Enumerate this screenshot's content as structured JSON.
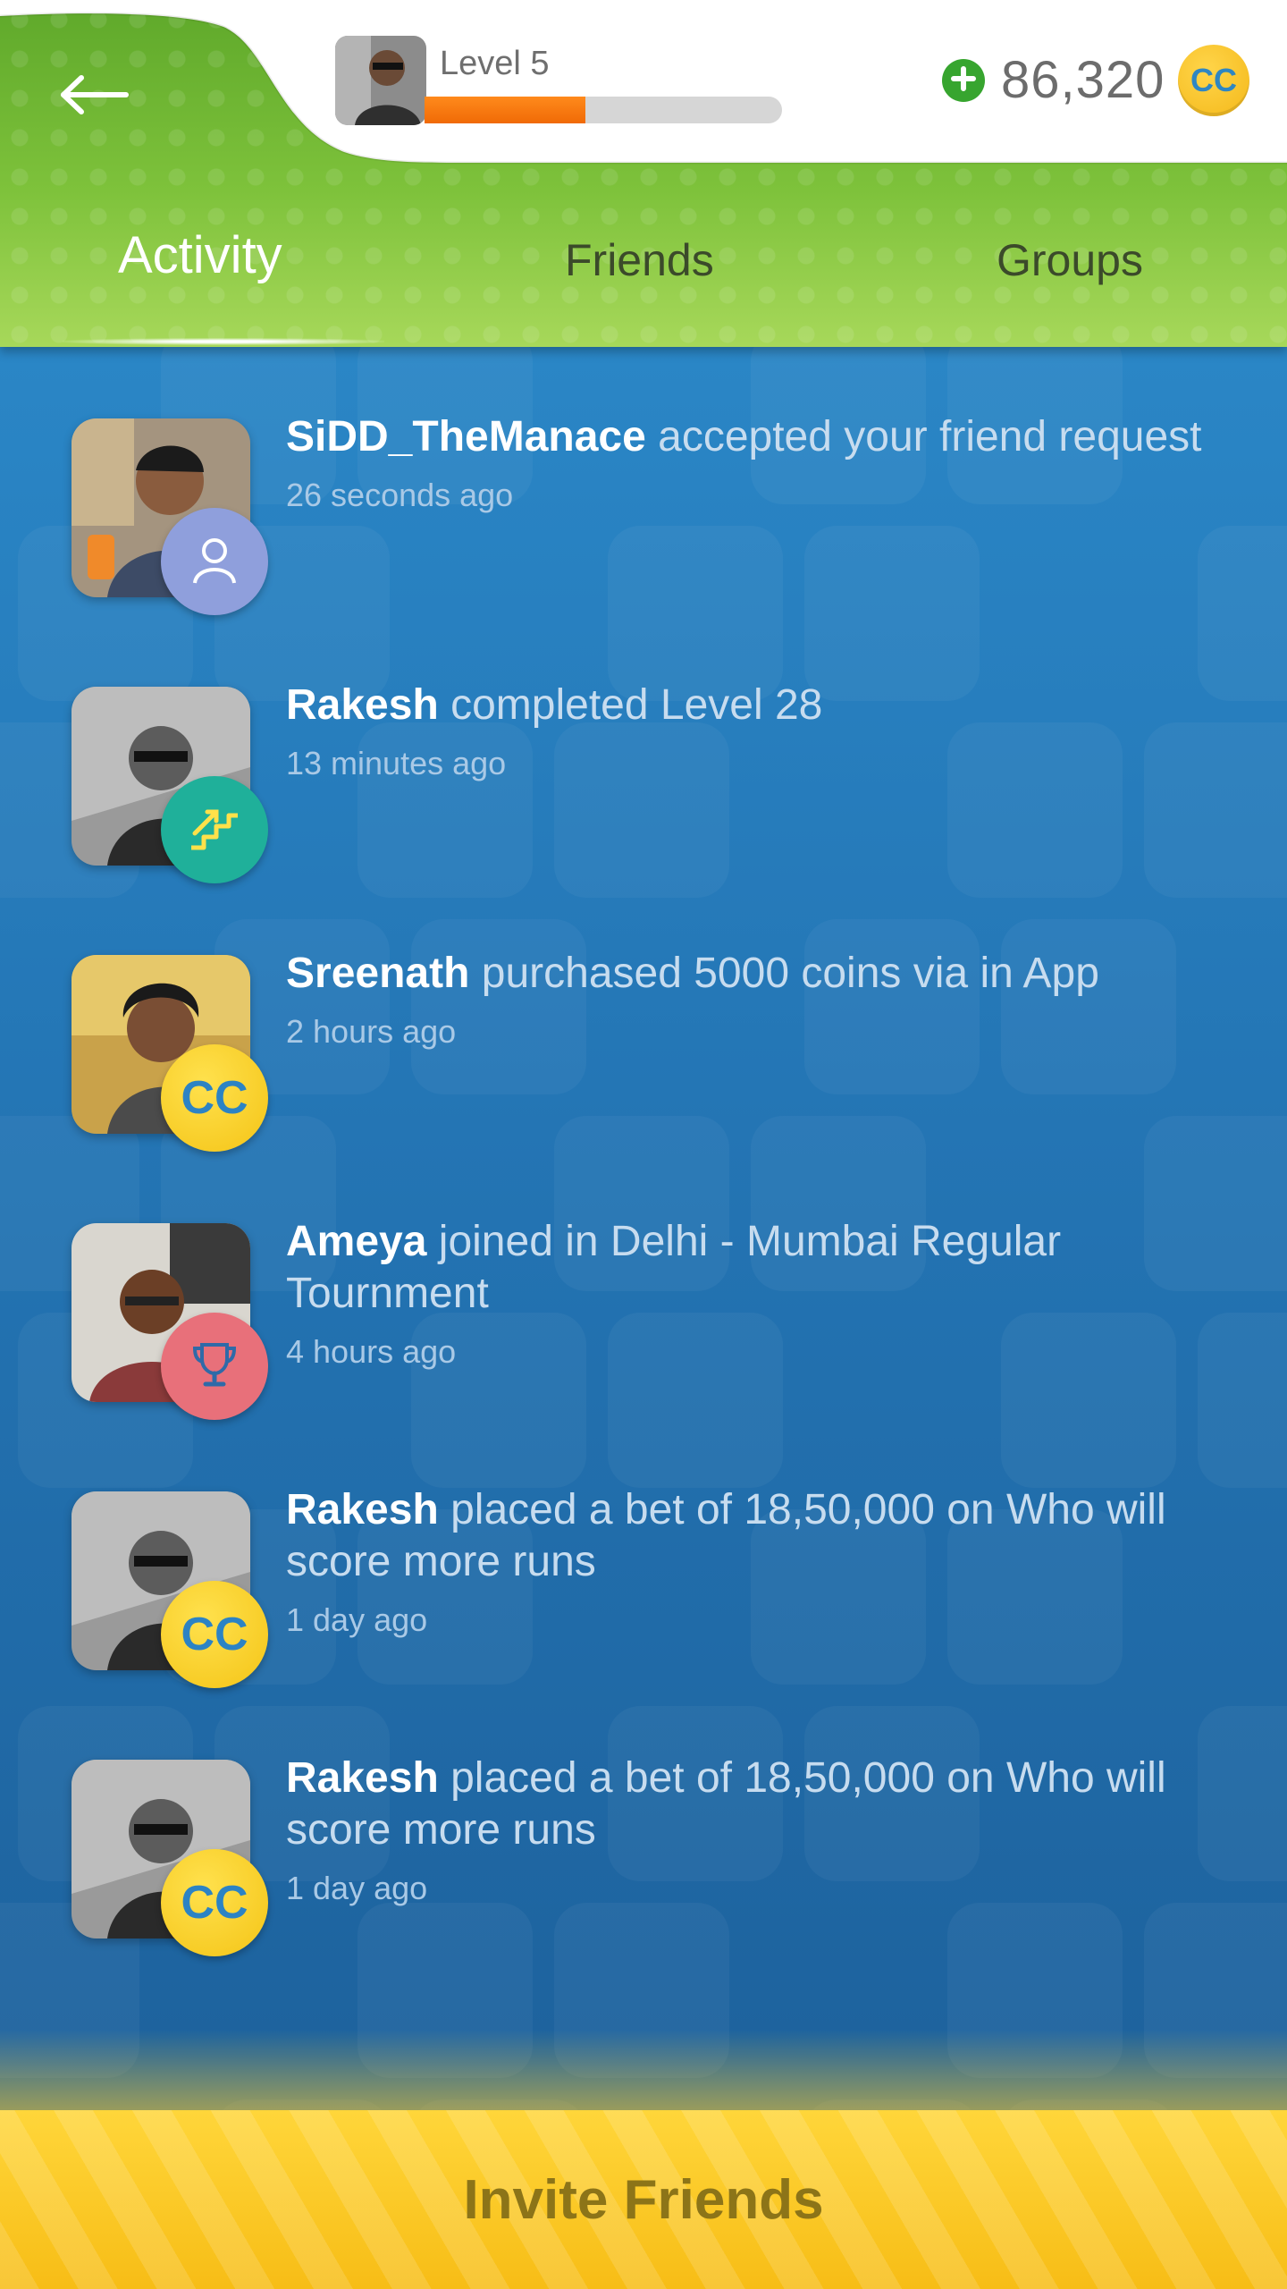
{
  "header": {
    "level_label": "Level 5",
    "level_progress": 0.45,
    "coins": "86,320",
    "coin_symbol": "CC",
    "back_icon": "arrow-left-icon",
    "add_coins_icon": "plus-icon"
  },
  "tabs": [
    {
      "label": "Activity",
      "active": true
    },
    {
      "label": "Friends",
      "active": false
    },
    {
      "label": "Groups",
      "active": false
    }
  ],
  "feed": [
    {
      "name": "SiDD_TheManace",
      "text": " accepted your friend request",
      "time": "26 seconds ago",
      "badge": "friend",
      "badge_icon": "person-icon"
    },
    {
      "name": "Rakesh",
      "text": " completed Level 28",
      "time": "13 minutes ago",
      "badge": "level",
      "badge_icon": "stairs-icon"
    },
    {
      "name": "Sreenath",
      "text": " purchased 5000 coins via in App",
      "time": "2 hours ago",
      "badge": "coin",
      "badge_icon": "CC"
    },
    {
      "name": "Ameya",
      "text": " joined in Delhi - Mumbai Regular Tournment",
      "time": "4 hours ago",
      "badge": "trophy",
      "badge_icon": "trophy-icon"
    },
    {
      "name": "Rakesh",
      "text": " placed a bet of 18,50,000 on Who will score more runs",
      "time": "1 day ago",
      "badge": "coin",
      "badge_icon": "CC"
    },
    {
      "name": "Rakesh",
      "text": " placed a bet of 18,50,000 on Who will score more runs",
      "time": "1 day ago",
      "badge": "coin",
      "badge_icon": "CC"
    }
  ],
  "invite": {
    "label": "Invite Friends"
  },
  "colors": {
    "header_green": "#7ec23b",
    "feed_blue": "#2373b2",
    "level_orange": "#f06a06",
    "coin_gold": "#f4c416",
    "invite_text": "#8c7418"
  }
}
